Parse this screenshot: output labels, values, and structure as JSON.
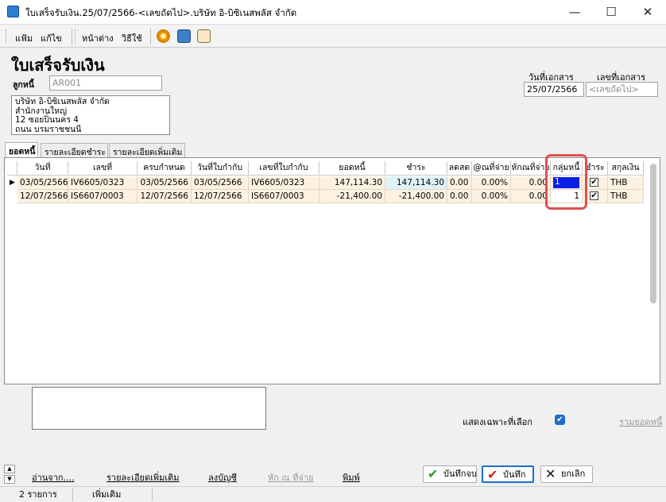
{
  "window": {
    "title": "ใบเสร็จรับเงิน.25/07/2566-<เลขถัดไป>.บริษัท อิ-บิซิเนสพลัส จำกัด"
  },
  "menu": [
    "แฟ้ม",
    "แก้ไข",
    "หน้าต่าง",
    "วิธีใช้"
  ],
  "form": {
    "title": "ใบเสร็จรับเงิน",
    "debtor_label": "ลูกหนี้",
    "debtor_code": "AR001",
    "doc_date_label": "วันที่เอกสาร",
    "doc_date": "25/07/2566",
    "doc_no_label": "เลขที่เอกสาร",
    "doc_no": "<เลขถัดไป>",
    "address": [
      "บริษัท อิ-บิซิเนสพลัส จำกัด",
      "สำนักงานใหญ่",
      "12 ซอยปิ่นนคร 4",
      "ถนน บรมราชชนนี"
    ]
  },
  "tabs": [
    "ยอดหนี้",
    "รายละเอียดชำระ",
    "รายละเอียดเพิ่มเติม"
  ],
  "grid": {
    "columns": [
      "วันที่",
      "เลขที่",
      "ครบกำหนด",
      "วันที่ใบกำกับ",
      "เลขที่ใบกำกับ",
      "ยอดหนี้",
      "ชำระ",
      "ลดสด",
      "@ณที่จ่าย",
      "หักณที่จ่าย",
      "กลุ่มหนี้",
      "ชำระ",
      "สกุลเงิน"
    ],
    "rows": [
      {
        "date": "03/05/2566",
        "no": "IV6605/0323",
        "due": "03/05/2566",
        "inv_date": "03/05/2566",
        "inv_no": "IV6605/0323",
        "debt": "147,114.30",
        "pay": "147,114.30",
        "disc": "0.00",
        "wht_rate": "0.00%",
        "wht": "0.00",
        "group": "1",
        "paid": true,
        "currency": "THB"
      },
      {
        "date": "12/07/2566",
        "no": "IS6607/0003",
        "due": "12/07/2566",
        "inv_date": "12/07/2566",
        "inv_no": "IS6607/0003",
        "debt": "-21,400.00",
        "pay": "-21,400.00",
        "disc": "0.00",
        "wht_rate": "0.00%",
        "wht": "0.00",
        "group": "1",
        "paid": true,
        "currency": "THB"
      }
    ]
  },
  "bottom": {
    "show_selected_label": "แสดงเฉพาะที่เลือก",
    "show_selected_checked": true,
    "total_link": "รวมยอดหนี้",
    "links": [
      "อ่านจาก....",
      "รายละเอียดเพิ่มเติม",
      "ลงบัญชี",
      "หัก ณ ที่จ่าย",
      "พิมพ์"
    ],
    "btn_save_close": "บันทึกจบ",
    "btn_save": "บันทึก",
    "btn_cancel": "ยกเลิก"
  },
  "status": {
    "count": "2 รายการ",
    "more": "เพิ่มเติม"
  },
  "colors": {
    "row_bg": "#fdf1e2",
    "pay_cell_bg": "#dff4f8",
    "selected_cell": "#0a1fe6",
    "highlight_box": "#e05050",
    "checkbox_blue": "#1e6ec8"
  }
}
